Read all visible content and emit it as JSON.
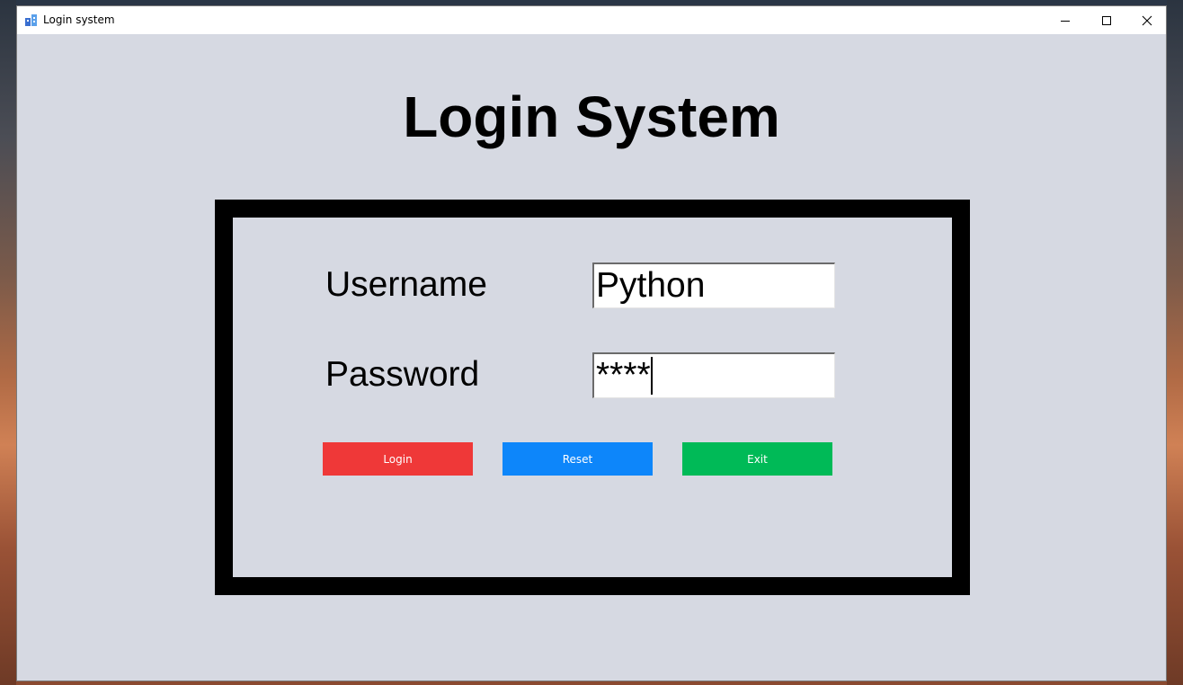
{
  "window": {
    "title": "Login system"
  },
  "app": {
    "heading": "Login System"
  },
  "form": {
    "username_label": "Username",
    "username_value": "Python",
    "password_label": "Password",
    "password_value": "****"
  },
  "buttons": {
    "login": "Login",
    "reset": "Reset",
    "exit": "Exit"
  },
  "colors": {
    "background": "#d6d9e2",
    "frame": "#000000",
    "login": "#ef3838",
    "reset": "#0d86fa",
    "exit": "#00ba57"
  },
  "icons": {
    "app": "app-feather-icon",
    "minimize": "minimize-icon",
    "maximize": "maximize-icon",
    "close": "close-icon"
  }
}
